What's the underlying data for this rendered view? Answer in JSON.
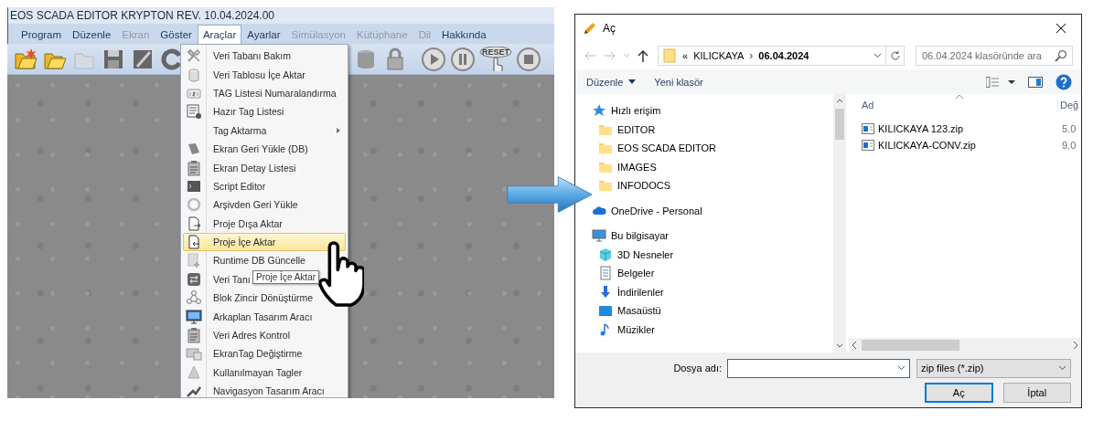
{
  "app": {
    "title": "EOS SCADA EDITOR KRYPTON REV. 10.04.2024.00",
    "menu": [
      {
        "label": "Program",
        "selected": false,
        "disabled": false
      },
      {
        "label": "Düzenle",
        "selected": false,
        "disabled": false
      },
      {
        "label": "Ekran",
        "selected": false,
        "disabled": true
      },
      {
        "label": "Göster",
        "selected": false,
        "disabled": false
      },
      {
        "label": "Araçlar",
        "selected": true,
        "disabled": false
      },
      {
        "label": "Ayarlar",
        "selected": false,
        "disabled": false
      },
      {
        "label": "Simülasyon",
        "selected": false,
        "disabled": true
      },
      {
        "label": "Kütüphane",
        "selected": false,
        "disabled": true
      },
      {
        "label": "Dil",
        "selected": false,
        "disabled": true
      },
      {
        "label": "Hakkında",
        "selected": false,
        "disabled": false
      }
    ],
    "toolbar": {
      "reset_label": "RESET"
    },
    "dropdown": [
      {
        "label": "Veri Tabanı Bakım",
        "selected": false,
        "submenu": false
      },
      {
        "label": "Veri Tablosu İçe Aktar",
        "selected": false,
        "submenu": false
      },
      {
        "label": "TAG Listesi Numaralandırma",
        "selected": false,
        "submenu": false
      },
      {
        "label": "Hazır Tag Listesi",
        "selected": false,
        "submenu": false
      },
      {
        "label": "Tag Aktarma",
        "selected": false,
        "submenu": true
      },
      {
        "label": "Ekran Geri Yükle (DB)",
        "selected": false,
        "submenu": false
      },
      {
        "label": "Ekran Detay Listesi",
        "selected": false,
        "submenu": false
      },
      {
        "label": "Script Editor",
        "selected": false,
        "submenu": false
      },
      {
        "label": "Arşivden Geri Yükle",
        "selected": false,
        "submenu": false
      },
      {
        "label": "Proje Dışa Aktar",
        "selected": false,
        "submenu": false
      },
      {
        "label": "Proje İçe Aktar",
        "selected": true,
        "submenu": false
      },
      {
        "label": "Runtime DB Güncelle",
        "selected": false,
        "submenu": false
      },
      {
        "label": "Veri Tanı",
        "selected": false,
        "submenu": false
      },
      {
        "label": "Blok Zincir Dönüştürme",
        "selected": false,
        "submenu": false
      },
      {
        "label": "Arkaplan Tasarım Aracı",
        "selected": false,
        "submenu": false
      },
      {
        "label": "Veri Adres Kontrol",
        "selected": false,
        "submenu": false
      },
      {
        "label": "EkranTag Değiştirme",
        "selected": false,
        "submenu": false
      },
      {
        "label": "Kullanılmayan Tagler",
        "selected": false,
        "submenu": false
      },
      {
        "label": "Navigasyon Tasarım Aracı",
        "selected": false,
        "submenu": false
      }
    ],
    "tooltip": "Proje İçe Aktar"
  },
  "dialog": {
    "title": "Aç",
    "address": {
      "overflow": "«",
      "separator": "›",
      "path": [
        {
          "label": "KILICKAYA",
          "current": false
        },
        {
          "label": "06.04.2024",
          "current": true
        }
      ]
    },
    "search": {
      "placeholder": "06.04.2024 klasöründe ara"
    },
    "commands": [
      {
        "label": "Düzenle",
        "dropdown": true
      },
      {
        "label": "Yeni klasör",
        "dropdown": false
      }
    ],
    "nav": [
      {
        "label": "Hızlı erişim",
        "kind": "quick",
        "children": [
          {
            "label": "EDITOR",
            "kind": "folder"
          },
          {
            "label": "EOS SCADA EDITOR",
            "kind": "folder"
          },
          {
            "label": "IMAGES",
            "kind": "folder"
          },
          {
            "label": "INFODOCS",
            "kind": "folder"
          }
        ]
      },
      {
        "label": "OneDrive - Personal",
        "kind": "cloud"
      },
      {
        "label": "Bu bilgisayar",
        "kind": "pc",
        "children": [
          {
            "label": "3D Nesneler",
            "kind": "cube"
          },
          {
            "label": "Belgeler",
            "kind": "docs"
          },
          {
            "label": "İndirilenler",
            "kind": "download"
          },
          {
            "label": "Masaüstü",
            "kind": "desktop"
          },
          {
            "label": "Müzikler",
            "kind": "music"
          }
        ]
      }
    ],
    "columns": [
      "Ad",
      "Değ"
    ],
    "files": [
      {
        "name": "KILICKAYA 123.zip",
        "column_2": "5.0"
      },
      {
        "name": "KILICKAYA-CONV.zip",
        "column_2": "9.0"
      }
    ],
    "filename_label": "Dosya adı:",
    "filter": "zip files (*.zip)",
    "buttons": [
      {
        "label": "Aç",
        "default": true
      },
      {
        "label": "İptal",
        "default": false
      }
    ]
  }
}
